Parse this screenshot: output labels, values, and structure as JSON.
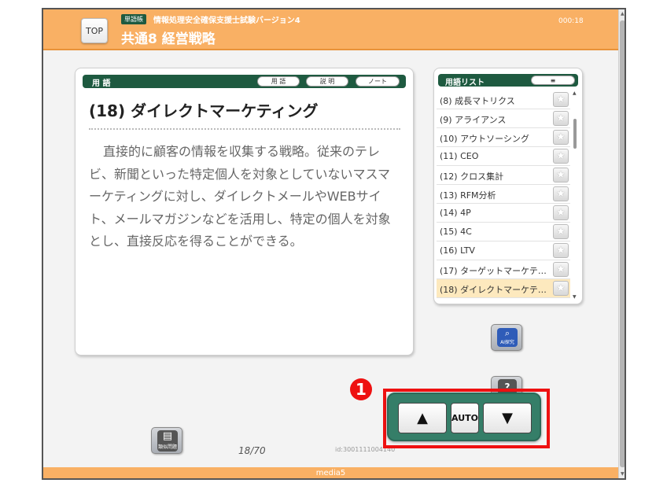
{
  "header": {
    "top_label": "TOP",
    "tag_label": "単語帳",
    "exam_title": "情報処理安全確保支援士試験バージョン4",
    "chapter_title": "共通8 経営戦略",
    "timer": "000:18"
  },
  "term_panel": {
    "section_label": "用 語",
    "buttons": [
      "用 語",
      "説 明",
      "ノート"
    ],
    "title": "(18) ダイレクトマーケティング",
    "description": "直接的に顧客の情報を収集する戦略。従来のテレビ、新聞といった特定個人を対象としていないマスマーケティングに対し、ダイレクトメールやWEBサイト、メールマガジンなどを活用し、特定の個人を対象とし、直接反応を得ることができる。"
  },
  "term_list": {
    "label": "用語リスト",
    "menu_label": "≡",
    "items": [
      "(8) 成長マトリクス",
      "(9) アライアンス",
      "(10) アウトソーシング",
      "(11) CEO",
      "(12) クロス集計",
      "(13) RFM分析",
      "(14) 4P",
      "(15) 4C",
      "(16) LTV",
      "(17) ターゲットマーケテ…",
      "(18) ダイレクトマーケテ…"
    ],
    "selected_index": 10
  },
  "tools": {
    "ai_label": "AI探究",
    "help_label": "?",
    "similar_label": "類似問題"
  },
  "footer": {
    "page_count": "18/70",
    "term_id": "id:3001111004140",
    "brand": "media5"
  },
  "nav": {
    "prev": "▲",
    "auto": "AUTO",
    "next": "▼",
    "callout": "1"
  },
  "colors": {
    "header_orange": "#f9b064",
    "bar_green": "#1e5a40",
    "nav_green": "#357e68",
    "highlight_red": "#ee1111",
    "selected_row": "#fde9be"
  }
}
